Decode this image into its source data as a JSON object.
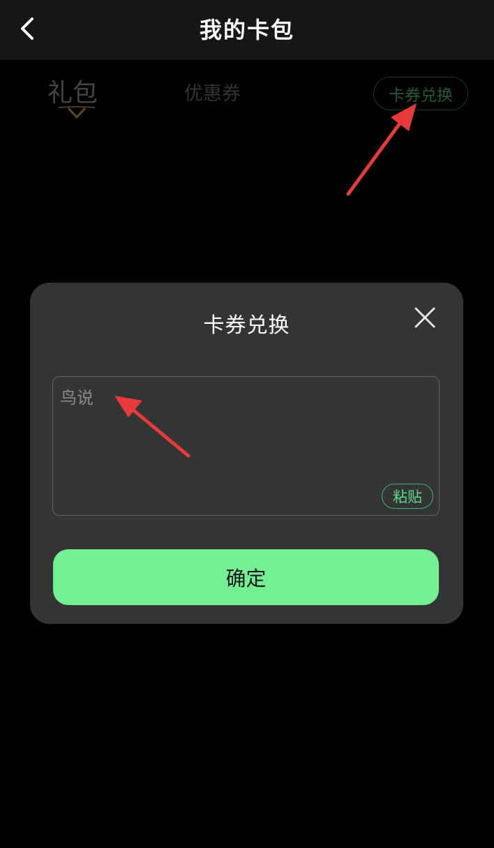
{
  "header": {
    "title": "我的卡包"
  },
  "tabs": [
    {
      "label": "礼包",
      "active": true
    },
    {
      "label": "优惠券",
      "active": false
    }
  ],
  "redeem_button": {
    "label": "卡券兑换"
  },
  "dialog": {
    "title": "卡券兑换",
    "input": {
      "value": "",
      "placeholder": "鸟说"
    },
    "paste_label": "粘贴",
    "confirm_label": "确定"
  },
  "colors": {
    "accent_green": "#74ef93",
    "paste_green": "#3cb86a",
    "annotation_red": "#e83a3a",
    "dialog_bg": "#333434"
  },
  "icons": {
    "back": "chevron-left-icon",
    "close": "close-icon",
    "tab_indicator": "chevron-down-icon"
  }
}
